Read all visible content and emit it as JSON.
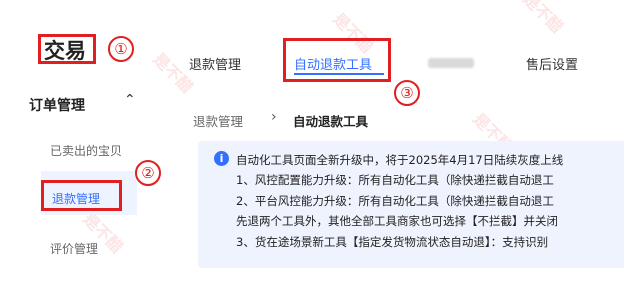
{
  "nav": {
    "brand": "交易",
    "group": "订单管理",
    "items": [
      {
        "label": "已卖出的宝贝"
      },
      {
        "label": "退款管理"
      },
      {
        "label": "评价管理"
      }
    ]
  },
  "tabs": [
    "退款管理",
    "自动退款工具",
    "售后设置"
  ],
  "annotations": [
    "①",
    "②",
    "③"
  ],
  "breadcrumb": [
    "退款管理",
    "自动退款工具"
  ],
  "notice": {
    "lines": [
      "自动化工具页面全新升级中，将于2025年4月17日陆续灰度上线",
      "1、风控配置能力升级：所有自动化工具（除快递拦截自动退工",
      "2、平台风控能力升级：所有自动化工具（除快递拦截自动退工",
      "先退两个工具外，其他全部工具商家也可选择【不拦截】并关闭",
      "3、货在途场景新工具【指定发货物流状态自动退】：支持识别"
    ]
  },
  "watermark": "是不醋",
  "colors": {
    "accent": "#3370ff",
    "annotation": "#e02020",
    "notice_bg": "#eef3fd"
  }
}
